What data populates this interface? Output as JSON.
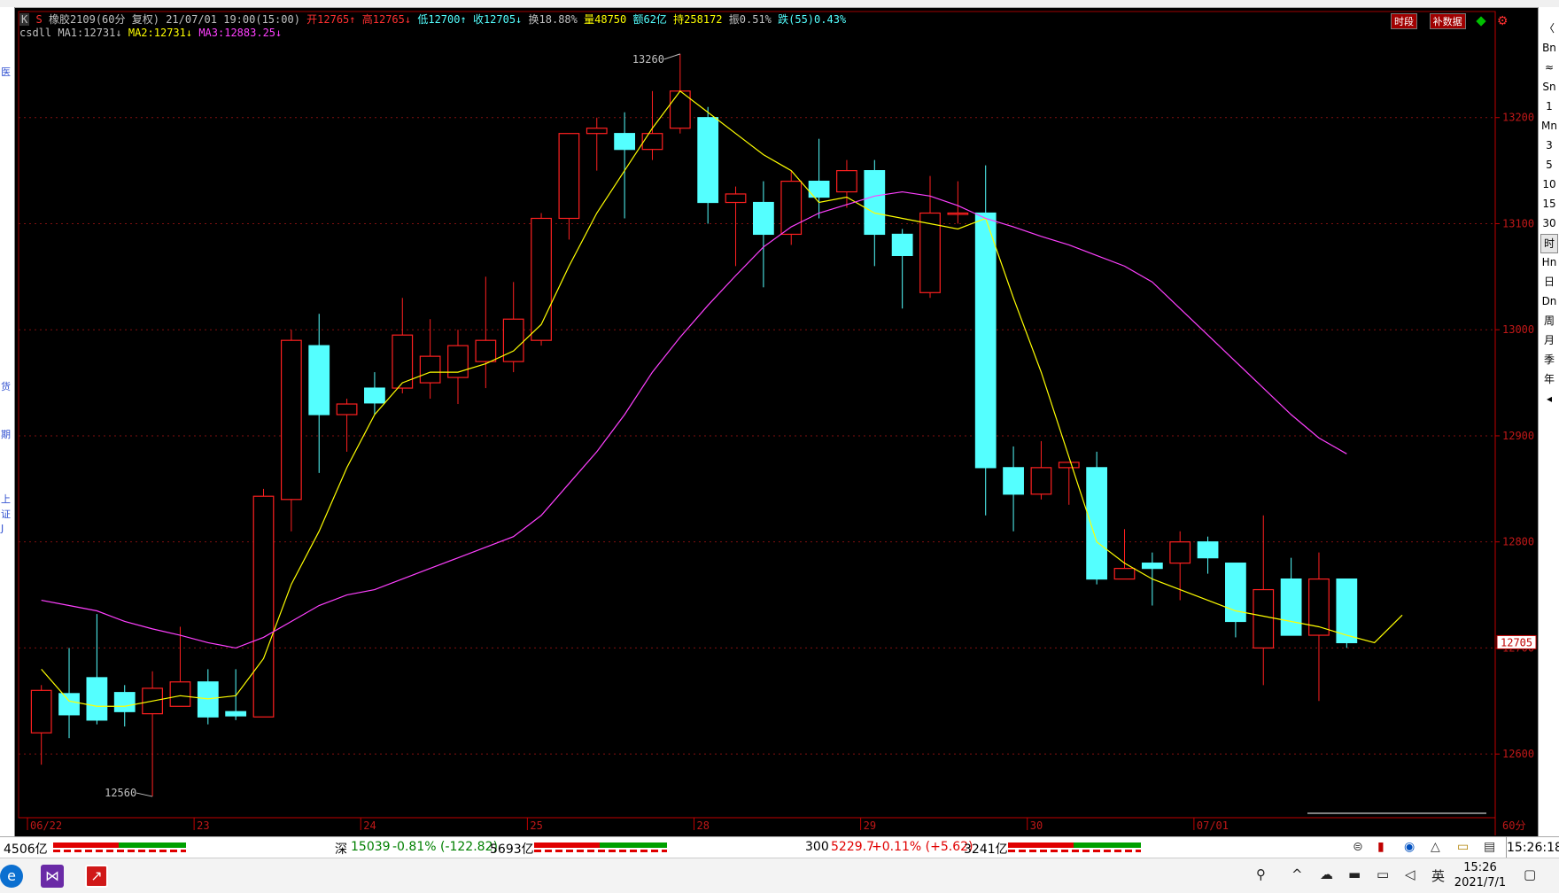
{
  "header": {
    "market_code": "K",
    "symbol_mark": "S",
    "name": "橡胶2109(60分 复权)",
    "datetime": "21/07/01 19:00(15:00)",
    "open": "开12765↑",
    "high": "高12765↓",
    "low": "低12700↑",
    "close": "收12705↓",
    "turnover": "换18.88%",
    "volume": "量48750",
    "amount": "额62亿",
    "position": "持258172",
    "amplitude": "振0.51%",
    "change": "跌(55)0.43%"
  },
  "indicators": {
    "name": "csdll",
    "ma1": "MA1:12731↓",
    "ma2": "MA2:12731↓",
    "ma3": "MA3:12883.25↓"
  },
  "top_right_buttons": [
    "时段",
    "补数据"
  ],
  "left_labels": [
    "医",
    "货",
    "期",
    "上",
    "证",
    "J"
  ],
  "right_sidebar": [
    "〈",
    "Bn",
    "≈",
    "Sn",
    "1",
    "Mn",
    "3",
    "5",
    "10",
    "15",
    "30",
    "时",
    "Hn",
    "日",
    "Dn",
    "周",
    "月",
    "季",
    "年",
    "◂"
  ],
  "right_sidebar_active": 11,
  "colors": {
    "up": "#ff2020",
    "down": "#54ffff",
    "ma1": "#ffff00",
    "ma3": "#ff40ff",
    "grid": "#801010"
  },
  "chart_data": {
    "type": "candlestick",
    "ylim": [
      12540,
      13300
    ],
    "y_ticks": [
      12600,
      12700,
      12800,
      12900,
      13000,
      13100,
      13200
    ],
    "x_ticks": [
      {
        "label": "06/22",
        "index": 0
      },
      {
        "label": "23",
        "index": 6
      },
      {
        "label": "24",
        "index": 12
      },
      {
        "label": "25",
        "index": 18
      },
      {
        "label": "28",
        "index": 24
      },
      {
        "label": "29",
        "index": 30
      },
      {
        "label": "30",
        "index": 36
      },
      {
        "label": "07/01",
        "index": 42
      }
    ],
    "period_label": "60分",
    "last_price_label": "12705",
    "max_label": {
      "index": 23,
      "value": 13260,
      "text": "13260"
    },
    "min_label": {
      "index": 4,
      "value": 12560,
      "text": "12560"
    },
    "candles": [
      {
        "o": 12620,
        "h": 12665,
        "l": 12590,
        "c": 12660
      },
      {
        "o": 12657,
        "h": 12700,
        "l": 12615,
        "c": 12637
      },
      {
        "o": 12672,
        "h": 12732,
        "l": 12628,
        "c": 12632
      },
      {
        "o": 12658,
        "h": 12665,
        "l": 12626,
        "c": 12640
      },
      {
        "o": 12638,
        "h": 12678,
        "l": 12560,
        "c": 12662
      },
      {
        "o": 12645,
        "h": 12720,
        "l": 12645,
        "c": 12668
      },
      {
        "o": 12668,
        "h": 12680,
        "l": 12628,
        "c": 12635
      },
      {
        "o": 12640,
        "h": 12680,
        "l": 12632,
        "c": 12636
      },
      {
        "o": 12635,
        "h": 12850,
        "l": 12635,
        "c": 12843
      },
      {
        "o": 12840,
        "h": 13000,
        "l": 12810,
        "c": 12990
      },
      {
        "o": 12985,
        "h": 13015,
        "l": 12865,
        "c": 12920
      },
      {
        "o": 12920,
        "h": 12935,
        "l": 12885,
        "c": 12930
      },
      {
        "o": 12945,
        "h": 12960,
        "l": 12920,
        "c": 12931
      },
      {
        "o": 12945,
        "h": 13030,
        "l": 12940,
        "c": 12995
      },
      {
        "o": 12950,
        "h": 13010,
        "l": 12935,
        "c": 12975
      },
      {
        "o": 12955,
        "h": 13000,
        "l": 12930,
        "c": 12985
      },
      {
        "o": 12970,
        "h": 13050,
        "l": 12945,
        "c": 12990
      },
      {
        "o": 12970,
        "h": 13045,
        "l": 12960,
        "c": 13010
      },
      {
        "o": 12990,
        "h": 13110,
        "l": 12985,
        "c": 13105
      },
      {
        "o": 13105,
        "h": 13185,
        "l": 13085,
        "c": 13185
      },
      {
        "o": 13185,
        "h": 13200,
        "l": 13150,
        "c": 13190
      },
      {
        "o": 13185,
        "h": 13205,
        "l": 13105,
        "c": 13170
      },
      {
        "o": 13170,
        "h": 13225,
        "l": 13160,
        "c": 13185
      },
      {
        "o": 13190,
        "h": 13260,
        "l": 13185,
        "c": 13225
      },
      {
        "o": 13200,
        "h": 13210,
        "l": 13100,
        "c": 13120
      },
      {
        "o": 13120,
        "h": 13135,
        "l": 13060,
        "c": 13128
      },
      {
        "o": 13120,
        "h": 13140,
        "l": 13040,
        "c": 13090
      },
      {
        "o": 13090,
        "h": 13150,
        "l": 13080,
        "c": 13140
      },
      {
        "o": 13140,
        "h": 13180,
        "l": 13105,
        "c": 13125
      },
      {
        "o": 13130,
        "h": 13160,
        "l": 13115,
        "c": 13150
      },
      {
        "o": 13150,
        "h": 13160,
        "l": 13060,
        "c": 13090
      },
      {
        "o": 13090,
        "h": 13095,
        "l": 13020,
        "c": 13070
      },
      {
        "o": 13035,
        "h": 13145,
        "l": 13030,
        "c": 13110
      },
      {
        "o": 13110,
        "h": 13140,
        "l": 13100,
        "c": 13110
      },
      {
        "o": 13110,
        "h": 13155,
        "l": 12825,
        "c": 12870
      },
      {
        "o": 12870,
        "h": 12890,
        "l": 12810,
        "c": 12845
      },
      {
        "o": 12845,
        "h": 12895,
        "l": 12840,
        "c": 12870
      },
      {
        "o": 12870,
        "h": 12875,
        "l": 12835,
        "c": 12875
      },
      {
        "o": 12870,
        "h": 12885,
        "l": 12760,
        "c": 12765
      },
      {
        "o": 12765,
        "h": 12812,
        "l": 12765,
        "c": 12775
      },
      {
        "o": 12780,
        "h": 12790,
        "l": 12740,
        "c": 12775
      },
      {
        "o": 12780,
        "h": 12810,
        "l": 12745,
        "c": 12800
      },
      {
        "o": 12800,
        "h": 12805,
        "l": 12770,
        "c": 12785
      },
      {
        "o": 12780,
        "h": 12780,
        "l": 12710,
        "c": 12725
      },
      {
        "o": 12700,
        "h": 12825,
        "l": 12665,
        "c": 12755
      },
      {
        "o": 12765,
        "h": 12785,
        "l": 12712,
        "c": 12712
      },
      {
        "o": 12712,
        "h": 12790,
        "l": 12650,
        "c": 12765
      },
      {
        "o": 12765,
        "h": 12765,
        "l": 12700,
        "c": 12705
      }
    ],
    "series": [
      {
        "name": "MA1",
        "values": [
          12680,
          12650,
          12645,
          12645,
          12650,
          12655,
          12652,
          12655,
          12690,
          12760,
          12810,
          12870,
          12920,
          12950,
          12960,
          12960,
          12968,
          12980,
          13005,
          13060,
          13110,
          13150,
          13190,
          13225,
          13205,
          13185,
          13165,
          13150,
          13120,
          13125,
          13110,
          13105,
          13100,
          13095,
          13105,
          13030,
          12960,
          12880,
          12800,
          12780,
          12765,
          12755,
          12745,
          12735,
          12730,
          12725,
          12720,
          12712,
          12705,
          12731
        ]
      },
      {
        "name": "MA3",
        "values": [
          12745,
          12740,
          12735,
          12725,
          12718,
          12712,
          12705,
          12700,
          12710,
          12725,
          12740,
          12750,
          12755,
          12765,
          12775,
          12785,
          12795,
          12805,
          12825,
          12855,
          12885,
          12920,
          12960,
          12993,
          13023,
          13051,
          13078,
          13097,
          13110,
          13118,
          13126,
          13130,
          13126,
          13117,
          13105,
          13097,
          13088,
          13080,
          13070,
          13060,
          13045,
          13020,
          12995,
          12970,
          12945,
          12920,
          12898,
          12883
        ]
      }
    ]
  },
  "statusbar": {
    "left_amount": "4506亿",
    "sz_label": "深",
    "sz_index": "15039",
    "sz_change": "-0.81% (-122.82)",
    "sz_amount": "5693亿",
    "hs300_label": "300",
    "hs300_index": "5229.7",
    "hs300_change": "+0.11% (+5.62)",
    "hs300_amount": "3241亿",
    "clock": "15:26:18"
  },
  "taskbar": {
    "ime": "英",
    "time": "15:26",
    "date": "2021/7/1"
  }
}
